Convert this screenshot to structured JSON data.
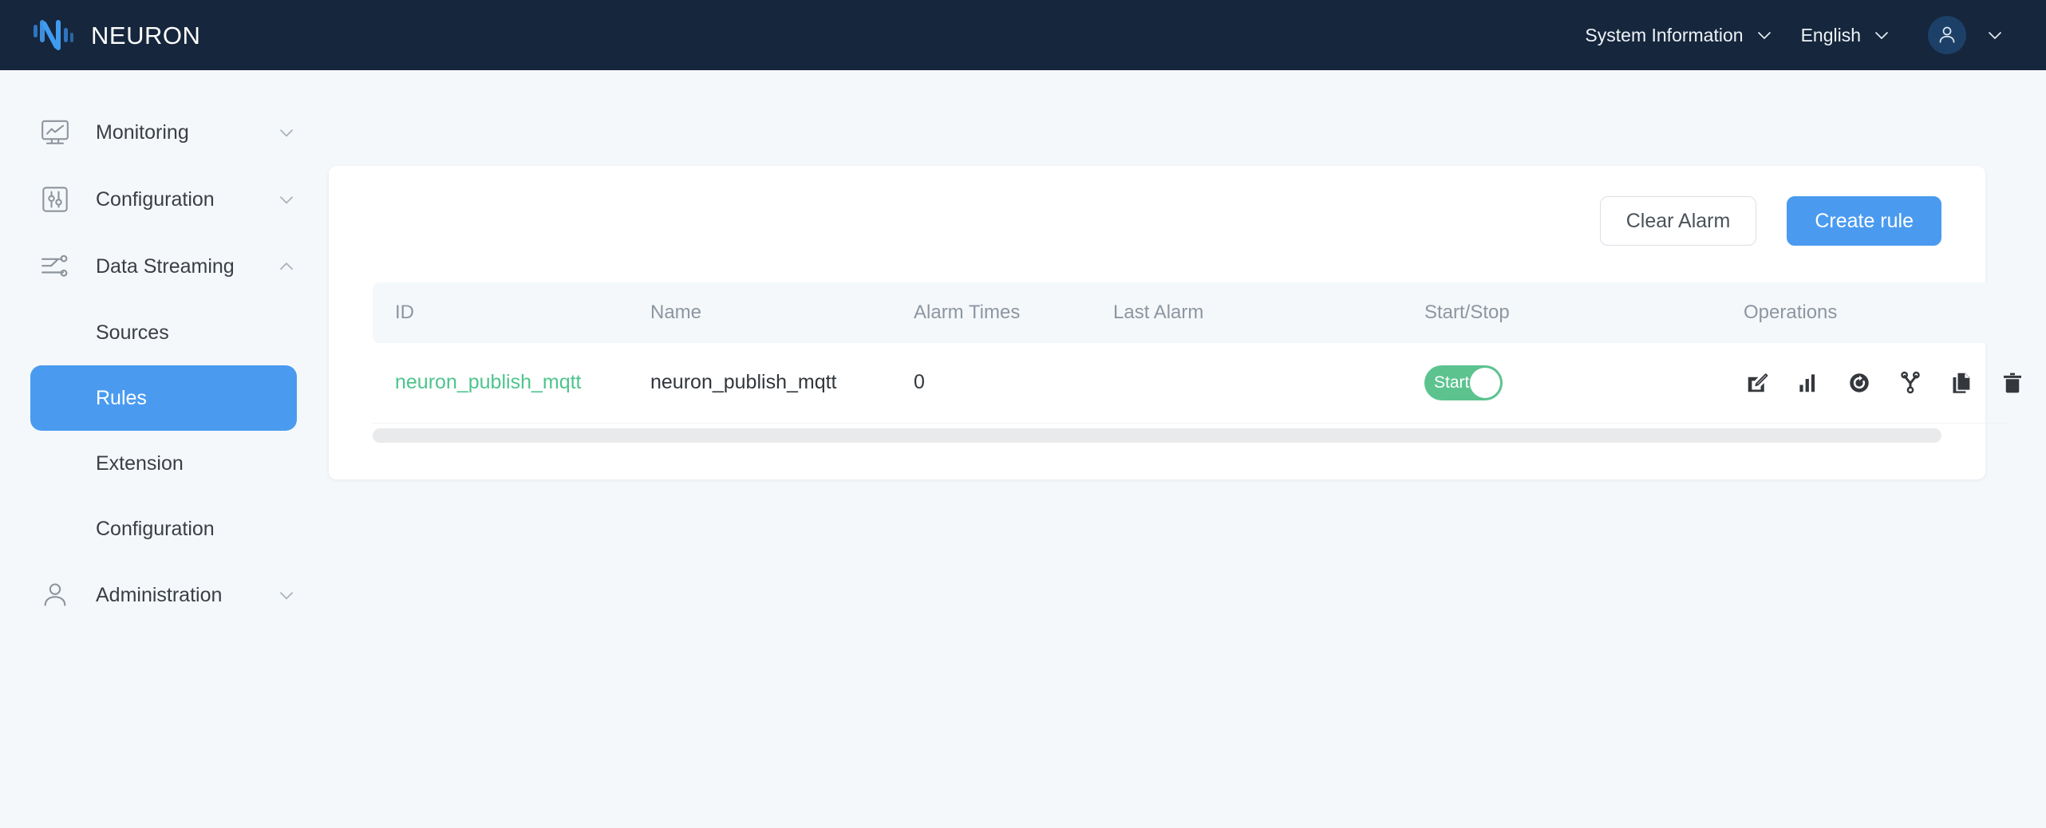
{
  "header": {
    "brand": "NEURON",
    "logo_icon": "neuron-waveform-logo",
    "menus": [
      {
        "label": "System Information",
        "icon": "chevron-down-icon"
      },
      {
        "label": "English",
        "icon": "chevron-down-icon"
      }
    ],
    "avatar_icon": "user-avatar-icon",
    "avatar_caret_icon": "chevron-down-icon",
    "background_color": "#16263c"
  },
  "sidebar": {
    "groups": [
      {
        "label": "Monitoring",
        "icon": "monitor-chart-icon",
        "caret_icon": "chevron-down-icon",
        "expanded": false,
        "children": []
      },
      {
        "label": "Configuration",
        "icon": "sliders-square-icon",
        "caret_icon": "chevron-down-icon",
        "expanded": false,
        "children": []
      },
      {
        "label": "Data Streaming",
        "icon": "data-streaming-nodes-icon",
        "caret_icon": "chevron-up-icon",
        "expanded": true,
        "children": [
          {
            "label": "Sources",
            "active": false
          },
          {
            "label": "Rules",
            "active": true
          },
          {
            "label": "Extension",
            "active": false
          },
          {
            "label": "Configuration",
            "active": false
          }
        ]
      },
      {
        "label": "Administration",
        "icon": "user-person-icon",
        "caret_icon": "chevron-down-icon",
        "expanded": false,
        "children": []
      }
    ],
    "active_color": "#4a9bf0"
  },
  "main": {
    "toolbar": {
      "clear_alarm_label": "Clear Alarm",
      "create_rule_label": "Create rule",
      "primary_color": "#4a9bf0"
    },
    "table": {
      "columns": [
        "ID",
        "Name",
        "Alarm Times",
        "Last Alarm",
        "Start/Stop",
        "Operations"
      ],
      "rows": [
        {
          "id": "neuron_publish_mqtt",
          "name": "neuron_publish_mqtt",
          "alarm_times": "0",
          "last_alarm": "",
          "toggle": {
            "label": "Start",
            "on": true,
            "color": "#5cc38f"
          },
          "operations": [
            "edit-icon",
            "statistics-bar-chart-icon",
            "restart-refresh-icon",
            "topology-branch-icon",
            "copy-document-icon",
            "delete-trash-icon"
          ]
        }
      ],
      "id_link_color": "#4ec48c"
    },
    "scrollbar_present": true
  }
}
